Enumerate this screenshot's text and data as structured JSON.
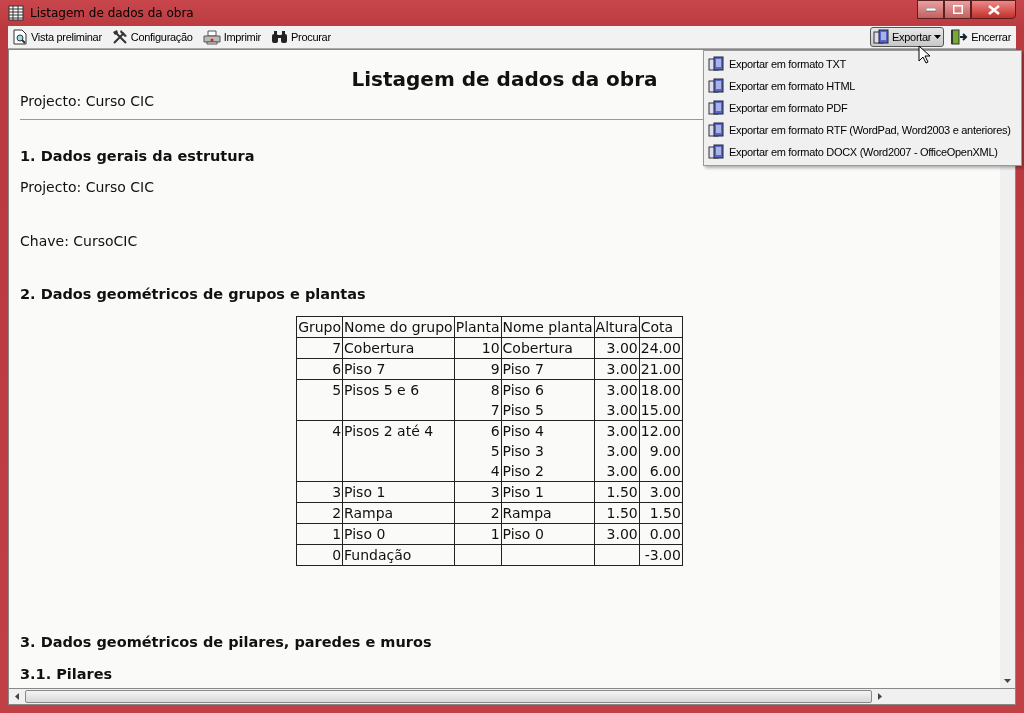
{
  "window": {
    "title": "Listagem de dados da obra"
  },
  "toolbar": {
    "left": [
      {
        "label": "Vista preliminar"
      },
      {
        "label": "Configuração"
      },
      {
        "label": "Imprimir"
      },
      {
        "label": "Procurar"
      }
    ],
    "right": [
      {
        "label": "Exportar",
        "dropdown": true,
        "pressed": true
      },
      {
        "label": "Encerrar",
        "dropdown": false,
        "pressed": false
      }
    ]
  },
  "export_menu": [
    {
      "label": "Exportar em formato TXT"
    },
    {
      "label": "Exportar em formato HTML"
    },
    {
      "label": "Exportar em formato PDF"
    },
    {
      "label": "Exportar em formato RTF (WordPad, Word2003 e anteriores)"
    },
    {
      "label": "Exportar em formato DOCX (Word2007 - OfficeOpenXML)"
    }
  ],
  "document": {
    "title": "Listagem de dados da obra",
    "subtitle": "Projecto: Curso CIC",
    "sections": [
      {
        "heading": "1. Dados gerais da estrutura",
        "paragraphs": [
          "Projecto: Curso CIC",
          "Chave: CursoCIC"
        ]
      },
      {
        "heading": "2. Dados geométricos de grupos e plantas",
        "table": {
          "columns": [
            "Grupo",
            "Nome do grupo",
            "Planta",
            "Nome planta",
            "Altura",
            "Cota"
          ],
          "groups": [
            {
              "grupo": "7",
              "nome": "Cobertura",
              "plantas": [
                {
                  "planta": "10",
                  "nome": "Cobertura",
                  "altura": "3.00",
                  "cota": "24.00"
                }
              ]
            },
            {
              "grupo": "6",
              "nome": "Piso 7",
              "plantas": [
                {
                  "planta": "9",
                  "nome": "Piso 7",
                  "altura": "3.00",
                  "cota": "21.00"
                }
              ]
            },
            {
              "grupo": "5",
              "nome": "Pisos 5 e 6",
              "plantas": [
                {
                  "planta": "8",
                  "nome": "Piso 6",
                  "altura": "3.00",
                  "cota": "18.00"
                },
                {
                  "planta": "7",
                  "nome": "Piso 5",
                  "altura": "3.00",
                  "cota": "15.00"
                }
              ]
            },
            {
              "grupo": "4",
              "nome": "Pisos 2 até 4",
              "plantas": [
                {
                  "planta": "6",
                  "nome": "Piso 4",
                  "altura": "3.00",
                  "cota": "12.00"
                },
                {
                  "planta": "5",
                  "nome": "Piso 3",
                  "altura": "3.00",
                  "cota": "9.00"
                },
                {
                  "planta": "4",
                  "nome": "Piso 2",
                  "altura": "3.00",
                  "cota": "6.00"
                }
              ]
            },
            {
              "grupo": "3",
              "nome": "Piso 1",
              "plantas": [
                {
                  "planta": "3",
                  "nome": "Piso 1",
                  "altura": "1.50",
                  "cota": "3.00"
                }
              ]
            },
            {
              "grupo": "2",
              "nome": "Rampa",
              "plantas": [
                {
                  "planta": "2",
                  "nome": "Rampa",
                  "altura": "1.50",
                  "cota": "1.50"
                }
              ]
            },
            {
              "grupo": "1",
              "nome": "Piso 0",
              "plantas": [
                {
                  "planta": "1",
                  "nome": "Piso 0",
                  "altura": "3.00",
                  "cota": "0.00"
                }
              ]
            },
            {
              "grupo": "0",
              "nome": "Fundação",
              "plantas": [
                {
                  "cota": "-3.00"
                }
              ]
            }
          ]
        }
      },
      {
        "heading": "3. Dados geométricos de pilares, paredes e muros"
      },
      {
        "heading": "3.1. Pilares",
        "sub": true
      }
    ]
  }
}
